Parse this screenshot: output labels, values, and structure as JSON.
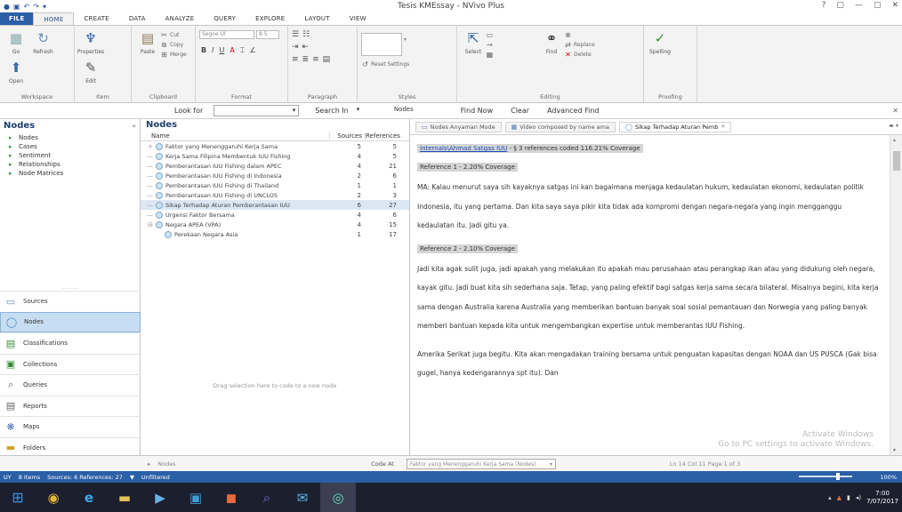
{
  "window": {
    "title": "Tesis KMEssay - NVivo Plus",
    "controls": [
      "?",
      "▢",
      "—",
      "▢",
      "✕"
    ]
  },
  "ribbon_tabs": [
    "FILE",
    "HOME",
    "CREATE",
    "DATA",
    "ANALYZE",
    "QUERY",
    "EXPLORE",
    "LAYOUT",
    "VIEW"
  ],
  "ribbon_groups": {
    "workspace": {
      "label": "Workspace",
      "buttons": [
        "Go",
        "Refresh",
        "Open"
      ]
    },
    "item": {
      "label": "Item",
      "buttons": [
        "Properties",
        "Edit"
      ]
    },
    "clipboard": {
      "label": "Clipboard",
      "buttons": [
        "Paste",
        "Cut",
        "Copy",
        "Merge"
      ]
    },
    "format": {
      "label": "Format",
      "font": "Segoe UI",
      "size": "8.5"
    },
    "paragraph": {
      "label": "Paragraph"
    },
    "styles": {
      "label": "Styles",
      "buttons": [
        "Reset Settings"
      ]
    },
    "editing": {
      "label": "Editing",
      "buttons": [
        "Select",
        "Find",
        "Replace",
        "Delete"
      ]
    },
    "proofing": {
      "label": "Proofing",
      "buttons": [
        "Spelling"
      ]
    }
  },
  "search": {
    "look_for_label": "Look for",
    "look_for_value": "",
    "search_in_label": "Search In",
    "search_in_value": "Nodes",
    "find_now": "Find Now",
    "clear": "Clear",
    "advanced_find": "Advanced Find"
  },
  "nav": {
    "heading": "Nodes",
    "tree": [
      "Nodes",
      "Cases",
      "Sentiment",
      "Relationships",
      "Node Matrices"
    ],
    "buttons": [
      "Sources",
      "Nodes",
      "Classifications",
      "Collections",
      "Queries",
      "Reports",
      "Maps",
      "Folders"
    ],
    "active": "Nodes"
  },
  "nodes_list": {
    "heading": "Nodes",
    "columns": {
      "name": "Name",
      "sources": "Sources",
      "references": "References"
    },
    "rows": [
      {
        "name": "Faktor yang Menenggaruhi Kerja Sama",
        "sources": "5",
        "references": "5",
        "child": false,
        "tree": "+"
      },
      {
        "name": "Kerja Sama Filipina Membentuk IUU Fishing",
        "sources": "4",
        "references": "5",
        "child": false,
        "tree": "—"
      },
      {
        "name": "Pemberantasan IUU Fishing dalam APEC",
        "sources": "4",
        "references": "21",
        "child": false,
        "tree": "—"
      },
      {
        "name": "Pemberantasan IUU Fishing di Indonesia",
        "sources": "2",
        "references": "6",
        "child": false,
        "tree": "—"
      },
      {
        "name": "Pemberantasan IUU Fishing di Thailand",
        "sources": "1",
        "references": "1",
        "child": false,
        "tree": "—"
      },
      {
        "name": "Pemberantasan IUU Fishing di UNCLOS",
        "sources": "2",
        "references": "3",
        "child": false,
        "tree": "—"
      },
      {
        "name": "Sikap Terhadap Aturan Pemberantasan IUU",
        "sources": "6",
        "references": "27",
        "child": false,
        "tree": "—",
        "selected": true
      },
      {
        "name": "Urgensi Faktor Bersama",
        "sources": "4",
        "references": "6",
        "child": false,
        "tree": "—"
      },
      {
        "name": "Negara APEA (VPA)",
        "sources": "4",
        "references": "15",
        "child": false,
        "tree": "⊟"
      },
      {
        "name": "Perekaan Negara Asia",
        "sources": "1",
        "references": "17",
        "child": true,
        "tree": ""
      }
    ],
    "empty_message": "Drag selection here to code to a new node"
  },
  "detail": {
    "tabs": [
      {
        "label": "Nodes Anyaman Mode",
        "active": false
      },
      {
        "label": "Video composed by name ama",
        "active": false
      },
      {
        "label": "Sikap Terhadap Aturan Pemb",
        "active": true
      }
    ],
    "header_link": "Internals\\Ahmad Satgas IUU",
    "header_rest": " - § 3 references coded 116.21% Coverage",
    "references": [
      {
        "label": "Reference 1 - 2.20% Coverage",
        "text": "MA: Kalau menurut saya sih kayaknya satgas ini kan bagaimana menjaga kedaulatan hukum, kedaulatan ekonomi, kedaulatan politik Indonesia, itu yang pertama. Dan kita saya saya pikir kita tidak ada kompromi dengan negara-negara yang ingin mengganggu kedaulatan itu. Jadi gitu ya."
      },
      {
        "label": "Reference 2 - 2.10% Coverage",
        "text": "Jadi kita agak sulit juga, jadi apakah yang melakukan itu apakah mau perusahaan atau perangkap ikan atau yang didukung oleh negara, kayak gitu. Jadi buat kita sih sederhana saja. Tetap, yang paling efektif bagi satgas kerja sama secara bilateral. Misalnya begini, kita kerja sama dengan Australia karena Australia yang memberikan bantuan banyak soal sosial pemantauan dan Norwegia yang paling banyak memberi bantuan kepada kita untuk mengembangkan expertise untuk memberantas IUU Fishing."
      },
      {
        "label": "",
        "text": "Amerika Serikat juga begitu. Kita akan mengadakan training bersama untuk penguatan kapasitas dengan NOAA dan US PUSCA (Gak bisa gugel, hanya kedengarannya spt itu). Dan"
      }
    ],
    "watermark_line1": "Activate Windows",
    "watermark_line2": "Go to PC settings to activate Windows."
  },
  "bottom": {
    "left": "Nodes",
    "code_at": "Code At",
    "in_field": "Faktor yang Menenggaruhi Kerja Sama (Nodes)",
    "right_info": "Ln 14  Col 11  Page 1 of 3"
  },
  "status": {
    "user": "UY",
    "items": "8 Items",
    "counts": "Sources: 6  References: 27",
    "filter": "Unfiltered",
    "zoom": "100%"
  },
  "taskbar": {
    "apps": [
      "chrome-icon",
      "ie-icon",
      "explorer-icon",
      "media-icon",
      "photo-icon",
      "office-icon",
      "nvivo-icon",
      "mail-icon",
      "dial-icon"
    ],
    "time": "7:00",
    "date": "7/07/2017"
  },
  "colors": {
    "accent": "#2b5fa6",
    "selected_row": "#dbe7f3",
    "nav_active": "#c7ddf1",
    "taskbar": "#1c1f2e"
  }
}
